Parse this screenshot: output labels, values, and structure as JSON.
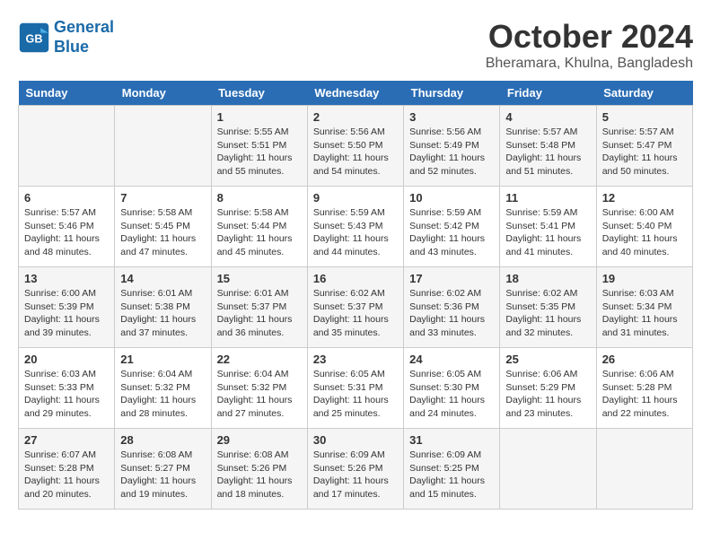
{
  "header": {
    "logo_line1": "General",
    "logo_line2": "Blue",
    "month": "October 2024",
    "location": "Bheramara, Khulna, Bangladesh"
  },
  "weekdays": [
    "Sunday",
    "Monday",
    "Tuesday",
    "Wednesday",
    "Thursday",
    "Friday",
    "Saturday"
  ],
  "weeks": [
    [
      {
        "day": "",
        "content": ""
      },
      {
        "day": "",
        "content": ""
      },
      {
        "day": "1",
        "content": "Sunrise: 5:55 AM\nSunset: 5:51 PM\nDaylight: 11 hours and 55 minutes."
      },
      {
        "day": "2",
        "content": "Sunrise: 5:56 AM\nSunset: 5:50 PM\nDaylight: 11 hours and 54 minutes."
      },
      {
        "day": "3",
        "content": "Sunrise: 5:56 AM\nSunset: 5:49 PM\nDaylight: 11 hours and 52 minutes."
      },
      {
        "day": "4",
        "content": "Sunrise: 5:57 AM\nSunset: 5:48 PM\nDaylight: 11 hours and 51 minutes."
      },
      {
        "day": "5",
        "content": "Sunrise: 5:57 AM\nSunset: 5:47 PM\nDaylight: 11 hours and 50 minutes."
      }
    ],
    [
      {
        "day": "6",
        "content": "Sunrise: 5:57 AM\nSunset: 5:46 PM\nDaylight: 11 hours and 48 minutes."
      },
      {
        "day": "7",
        "content": "Sunrise: 5:58 AM\nSunset: 5:45 PM\nDaylight: 11 hours and 47 minutes."
      },
      {
        "day": "8",
        "content": "Sunrise: 5:58 AM\nSunset: 5:44 PM\nDaylight: 11 hours and 45 minutes."
      },
      {
        "day": "9",
        "content": "Sunrise: 5:59 AM\nSunset: 5:43 PM\nDaylight: 11 hours and 44 minutes."
      },
      {
        "day": "10",
        "content": "Sunrise: 5:59 AM\nSunset: 5:42 PM\nDaylight: 11 hours and 43 minutes."
      },
      {
        "day": "11",
        "content": "Sunrise: 5:59 AM\nSunset: 5:41 PM\nDaylight: 11 hours and 41 minutes."
      },
      {
        "day": "12",
        "content": "Sunrise: 6:00 AM\nSunset: 5:40 PM\nDaylight: 11 hours and 40 minutes."
      }
    ],
    [
      {
        "day": "13",
        "content": "Sunrise: 6:00 AM\nSunset: 5:39 PM\nDaylight: 11 hours and 39 minutes."
      },
      {
        "day": "14",
        "content": "Sunrise: 6:01 AM\nSunset: 5:38 PM\nDaylight: 11 hours and 37 minutes."
      },
      {
        "day": "15",
        "content": "Sunrise: 6:01 AM\nSunset: 5:37 PM\nDaylight: 11 hours and 36 minutes."
      },
      {
        "day": "16",
        "content": "Sunrise: 6:02 AM\nSunset: 5:37 PM\nDaylight: 11 hours and 35 minutes."
      },
      {
        "day": "17",
        "content": "Sunrise: 6:02 AM\nSunset: 5:36 PM\nDaylight: 11 hours and 33 minutes."
      },
      {
        "day": "18",
        "content": "Sunrise: 6:02 AM\nSunset: 5:35 PM\nDaylight: 11 hours and 32 minutes."
      },
      {
        "day": "19",
        "content": "Sunrise: 6:03 AM\nSunset: 5:34 PM\nDaylight: 11 hours and 31 minutes."
      }
    ],
    [
      {
        "day": "20",
        "content": "Sunrise: 6:03 AM\nSunset: 5:33 PM\nDaylight: 11 hours and 29 minutes."
      },
      {
        "day": "21",
        "content": "Sunrise: 6:04 AM\nSunset: 5:32 PM\nDaylight: 11 hours and 28 minutes."
      },
      {
        "day": "22",
        "content": "Sunrise: 6:04 AM\nSunset: 5:32 PM\nDaylight: 11 hours and 27 minutes."
      },
      {
        "day": "23",
        "content": "Sunrise: 6:05 AM\nSunset: 5:31 PM\nDaylight: 11 hours and 25 minutes."
      },
      {
        "day": "24",
        "content": "Sunrise: 6:05 AM\nSunset: 5:30 PM\nDaylight: 11 hours and 24 minutes."
      },
      {
        "day": "25",
        "content": "Sunrise: 6:06 AM\nSunset: 5:29 PM\nDaylight: 11 hours and 23 minutes."
      },
      {
        "day": "26",
        "content": "Sunrise: 6:06 AM\nSunset: 5:28 PM\nDaylight: 11 hours and 22 minutes."
      }
    ],
    [
      {
        "day": "27",
        "content": "Sunrise: 6:07 AM\nSunset: 5:28 PM\nDaylight: 11 hours and 20 minutes."
      },
      {
        "day": "28",
        "content": "Sunrise: 6:08 AM\nSunset: 5:27 PM\nDaylight: 11 hours and 19 minutes."
      },
      {
        "day": "29",
        "content": "Sunrise: 6:08 AM\nSunset: 5:26 PM\nDaylight: 11 hours and 18 minutes."
      },
      {
        "day": "30",
        "content": "Sunrise: 6:09 AM\nSunset: 5:26 PM\nDaylight: 11 hours and 17 minutes."
      },
      {
        "day": "31",
        "content": "Sunrise: 6:09 AM\nSunset: 5:25 PM\nDaylight: 11 hours and 15 minutes."
      },
      {
        "day": "",
        "content": ""
      },
      {
        "day": "",
        "content": ""
      }
    ]
  ]
}
